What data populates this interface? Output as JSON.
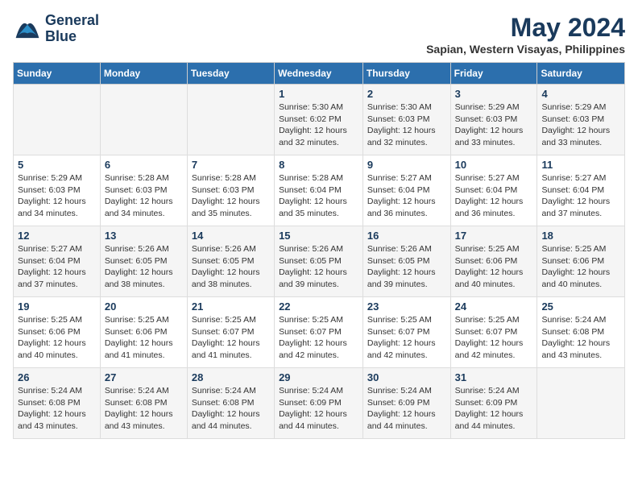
{
  "header": {
    "logo_line1": "General",
    "logo_line2": "Blue",
    "month_year": "May 2024",
    "location": "Sapian, Western Visayas, Philippines"
  },
  "weekdays": [
    "Sunday",
    "Monday",
    "Tuesday",
    "Wednesday",
    "Thursday",
    "Friday",
    "Saturday"
  ],
  "weeks": [
    [
      {
        "day": "",
        "info": ""
      },
      {
        "day": "",
        "info": ""
      },
      {
        "day": "",
        "info": ""
      },
      {
        "day": "1",
        "info": "Sunrise: 5:30 AM\nSunset: 6:02 PM\nDaylight: 12 hours\nand 32 minutes."
      },
      {
        "day": "2",
        "info": "Sunrise: 5:30 AM\nSunset: 6:03 PM\nDaylight: 12 hours\nand 32 minutes."
      },
      {
        "day": "3",
        "info": "Sunrise: 5:29 AM\nSunset: 6:03 PM\nDaylight: 12 hours\nand 33 minutes."
      },
      {
        "day": "4",
        "info": "Sunrise: 5:29 AM\nSunset: 6:03 PM\nDaylight: 12 hours\nand 33 minutes."
      }
    ],
    [
      {
        "day": "5",
        "info": "Sunrise: 5:29 AM\nSunset: 6:03 PM\nDaylight: 12 hours\nand 34 minutes."
      },
      {
        "day": "6",
        "info": "Sunrise: 5:28 AM\nSunset: 6:03 PM\nDaylight: 12 hours\nand 34 minutes."
      },
      {
        "day": "7",
        "info": "Sunrise: 5:28 AM\nSunset: 6:03 PM\nDaylight: 12 hours\nand 35 minutes."
      },
      {
        "day": "8",
        "info": "Sunrise: 5:28 AM\nSunset: 6:04 PM\nDaylight: 12 hours\nand 35 minutes."
      },
      {
        "day": "9",
        "info": "Sunrise: 5:27 AM\nSunset: 6:04 PM\nDaylight: 12 hours\nand 36 minutes."
      },
      {
        "day": "10",
        "info": "Sunrise: 5:27 AM\nSunset: 6:04 PM\nDaylight: 12 hours\nand 36 minutes."
      },
      {
        "day": "11",
        "info": "Sunrise: 5:27 AM\nSunset: 6:04 PM\nDaylight: 12 hours\nand 37 minutes."
      }
    ],
    [
      {
        "day": "12",
        "info": "Sunrise: 5:27 AM\nSunset: 6:04 PM\nDaylight: 12 hours\nand 37 minutes."
      },
      {
        "day": "13",
        "info": "Sunrise: 5:26 AM\nSunset: 6:05 PM\nDaylight: 12 hours\nand 38 minutes."
      },
      {
        "day": "14",
        "info": "Sunrise: 5:26 AM\nSunset: 6:05 PM\nDaylight: 12 hours\nand 38 minutes."
      },
      {
        "day": "15",
        "info": "Sunrise: 5:26 AM\nSunset: 6:05 PM\nDaylight: 12 hours\nand 39 minutes."
      },
      {
        "day": "16",
        "info": "Sunrise: 5:26 AM\nSunset: 6:05 PM\nDaylight: 12 hours\nand 39 minutes."
      },
      {
        "day": "17",
        "info": "Sunrise: 5:25 AM\nSunset: 6:06 PM\nDaylight: 12 hours\nand 40 minutes."
      },
      {
        "day": "18",
        "info": "Sunrise: 5:25 AM\nSunset: 6:06 PM\nDaylight: 12 hours\nand 40 minutes."
      }
    ],
    [
      {
        "day": "19",
        "info": "Sunrise: 5:25 AM\nSunset: 6:06 PM\nDaylight: 12 hours\nand 40 minutes."
      },
      {
        "day": "20",
        "info": "Sunrise: 5:25 AM\nSunset: 6:06 PM\nDaylight: 12 hours\nand 41 minutes."
      },
      {
        "day": "21",
        "info": "Sunrise: 5:25 AM\nSunset: 6:07 PM\nDaylight: 12 hours\nand 41 minutes."
      },
      {
        "day": "22",
        "info": "Sunrise: 5:25 AM\nSunset: 6:07 PM\nDaylight: 12 hours\nand 42 minutes."
      },
      {
        "day": "23",
        "info": "Sunrise: 5:25 AM\nSunset: 6:07 PM\nDaylight: 12 hours\nand 42 minutes."
      },
      {
        "day": "24",
        "info": "Sunrise: 5:25 AM\nSunset: 6:07 PM\nDaylight: 12 hours\nand 42 minutes."
      },
      {
        "day": "25",
        "info": "Sunrise: 5:24 AM\nSunset: 6:08 PM\nDaylight: 12 hours\nand 43 minutes."
      }
    ],
    [
      {
        "day": "26",
        "info": "Sunrise: 5:24 AM\nSunset: 6:08 PM\nDaylight: 12 hours\nand 43 minutes."
      },
      {
        "day": "27",
        "info": "Sunrise: 5:24 AM\nSunset: 6:08 PM\nDaylight: 12 hours\nand 43 minutes."
      },
      {
        "day": "28",
        "info": "Sunrise: 5:24 AM\nSunset: 6:08 PM\nDaylight: 12 hours\nand 44 minutes."
      },
      {
        "day": "29",
        "info": "Sunrise: 5:24 AM\nSunset: 6:09 PM\nDaylight: 12 hours\nand 44 minutes."
      },
      {
        "day": "30",
        "info": "Sunrise: 5:24 AM\nSunset: 6:09 PM\nDaylight: 12 hours\nand 44 minutes."
      },
      {
        "day": "31",
        "info": "Sunrise: 5:24 AM\nSunset: 6:09 PM\nDaylight: 12 hours\nand 44 minutes."
      },
      {
        "day": "",
        "info": ""
      }
    ]
  ]
}
